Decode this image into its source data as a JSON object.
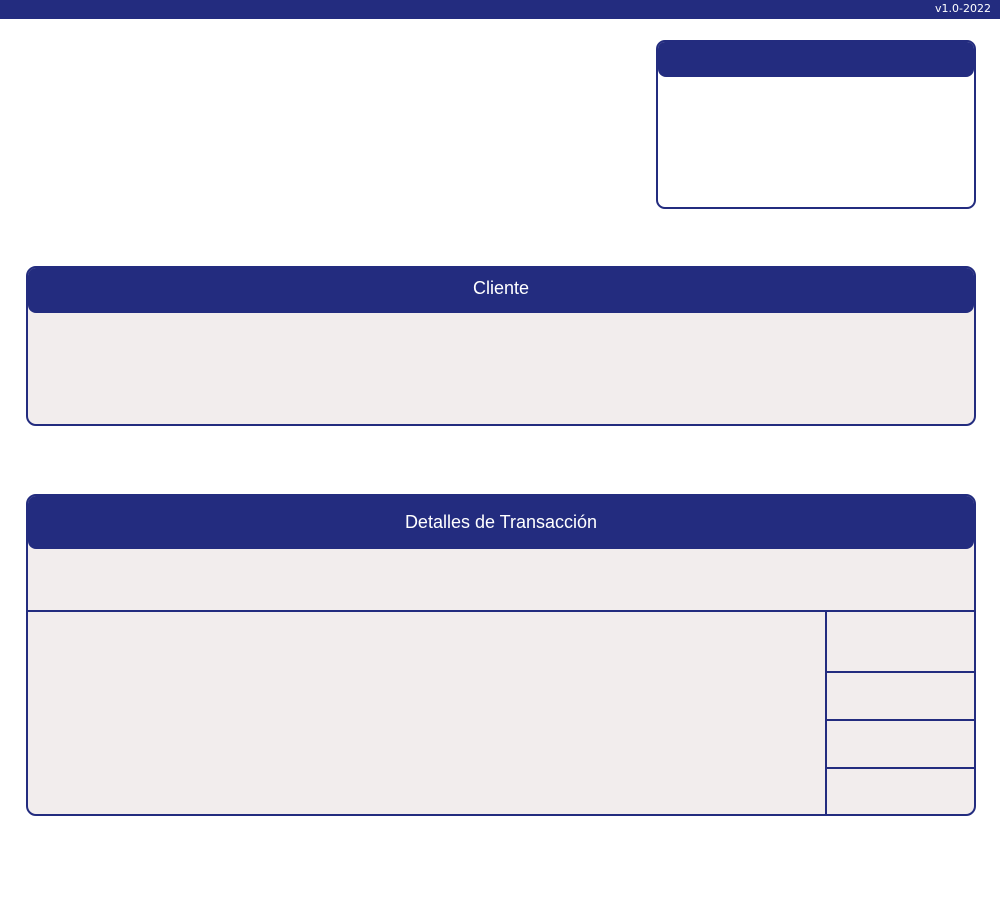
{
  "header": {
    "version": "v1.0-2022"
  },
  "info_card": {
    "title": ""
  },
  "client_section": {
    "title": "Cliente"
  },
  "transaction_section": {
    "title": "Detalles de Transacción"
  },
  "colors": {
    "brand": "#232c7f",
    "panel_background": "#f2eded",
    "page_background": "#ffffff"
  }
}
